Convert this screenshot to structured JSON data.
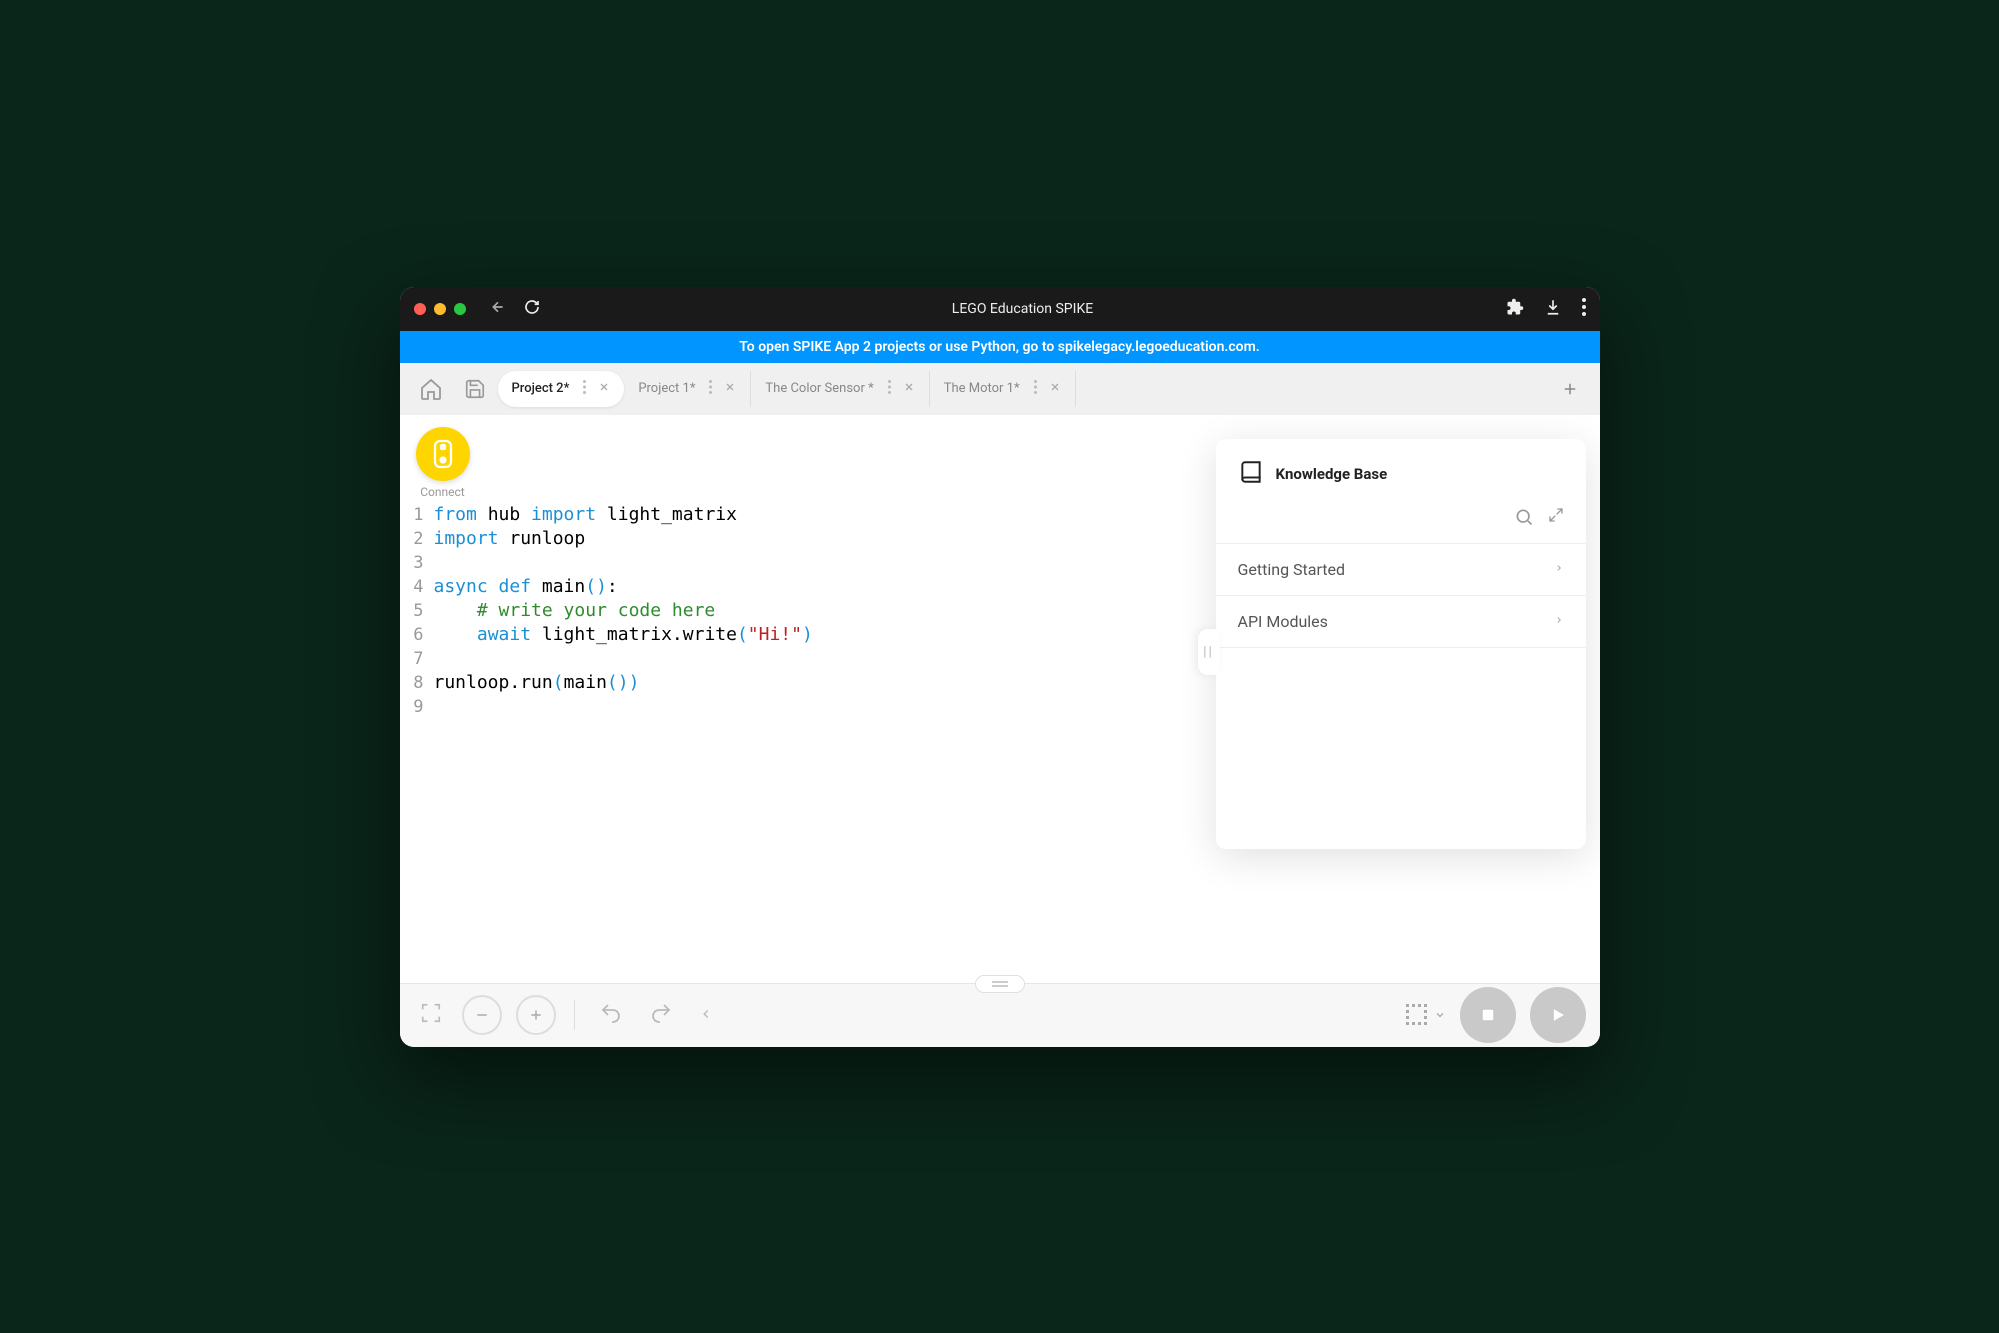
{
  "window": {
    "title": "LEGO Education SPIKE"
  },
  "banner": {
    "text": "To open SPIKE App 2 projects or use Python, go to spikelegacy.legoeducation.com."
  },
  "tabs": [
    {
      "label": "Project 2*",
      "active": true
    },
    {
      "label": "Project 1*",
      "active": false
    },
    {
      "label": "The Color Sensor *",
      "active": false
    },
    {
      "label": "The Motor 1*",
      "active": false
    }
  ],
  "connect": {
    "label": "Connect"
  },
  "code": {
    "lines": [
      {
        "n": 1,
        "tokens": [
          [
            "kw",
            "from"
          ],
          [
            "",
            " hub "
          ],
          [
            "kw",
            "import"
          ],
          [
            "",
            " light_matrix"
          ]
        ]
      },
      {
        "n": 2,
        "tokens": [
          [
            "kw",
            "import"
          ],
          [
            "",
            " runloop"
          ]
        ]
      },
      {
        "n": 3,
        "tokens": [
          [
            "",
            ""
          ]
        ]
      },
      {
        "n": 4,
        "tokens": [
          [
            "kw",
            "async def"
          ],
          [
            "",
            " main"
          ],
          [
            "paren",
            "()"
          ],
          [
            "",
            ":"
          ]
        ]
      },
      {
        "n": 5,
        "tokens": [
          [
            "",
            "    "
          ],
          [
            "comment",
            "# write your code here"
          ]
        ]
      },
      {
        "n": 6,
        "tokens": [
          [
            "",
            "    "
          ],
          [
            "kw",
            "await"
          ],
          [
            "",
            " light_matrix.write"
          ],
          [
            "paren",
            "("
          ],
          [
            "str",
            "\"Hi!\""
          ],
          [
            "paren",
            ")"
          ]
        ]
      },
      {
        "n": 7,
        "tokens": [
          [
            "",
            ""
          ]
        ]
      },
      {
        "n": 8,
        "tokens": [
          [
            "",
            "runloop.run"
          ],
          [
            "paren",
            "("
          ],
          [
            "",
            "main"
          ],
          [
            "paren",
            "())"
          ]
        ]
      },
      {
        "n": 9,
        "tokens": [
          [
            "",
            ""
          ]
        ]
      }
    ]
  },
  "knowledge_base": {
    "title": "Knowledge Base",
    "items": [
      {
        "label": "Getting Started"
      },
      {
        "label": "API Modules"
      }
    ]
  }
}
